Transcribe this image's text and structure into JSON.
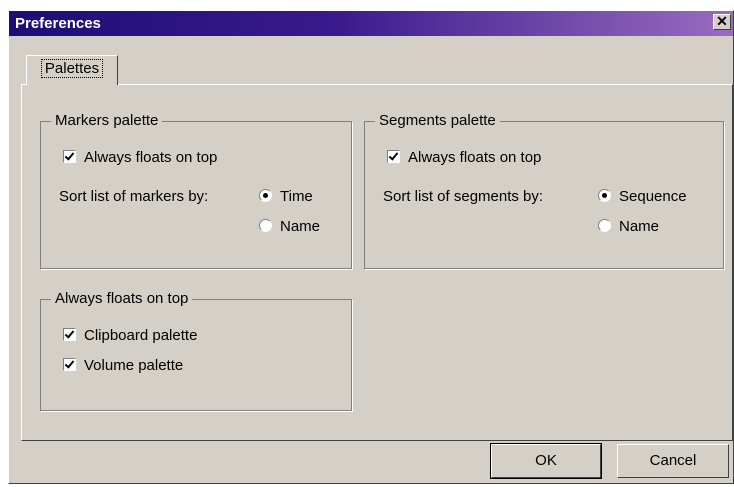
{
  "window": {
    "title": "Preferences",
    "close_glyph": "✕"
  },
  "tabs": [
    {
      "label": "Palettes"
    }
  ],
  "markers": {
    "legend": "Markers palette",
    "always_on_top": {
      "label": "Always floats on top",
      "checked": true
    },
    "sort_label": "Sort list of markers by:",
    "options": [
      {
        "label": "Time",
        "selected": true
      },
      {
        "label": "Name",
        "selected": false
      }
    ]
  },
  "segments": {
    "legend": "Segments palette",
    "always_on_top": {
      "label": "Always floats on top",
      "checked": true
    },
    "sort_label": "Sort list of segments by:",
    "options": [
      {
        "label": "Sequence",
        "selected": true
      },
      {
        "label": "Name",
        "selected": false
      }
    ]
  },
  "floats": {
    "legend": "Always floats on top",
    "items": [
      {
        "label": "Clipboard palette",
        "checked": true
      },
      {
        "label": "Volume palette",
        "checked": true
      }
    ]
  },
  "buttons": {
    "ok": "OK",
    "cancel": "Cancel"
  }
}
